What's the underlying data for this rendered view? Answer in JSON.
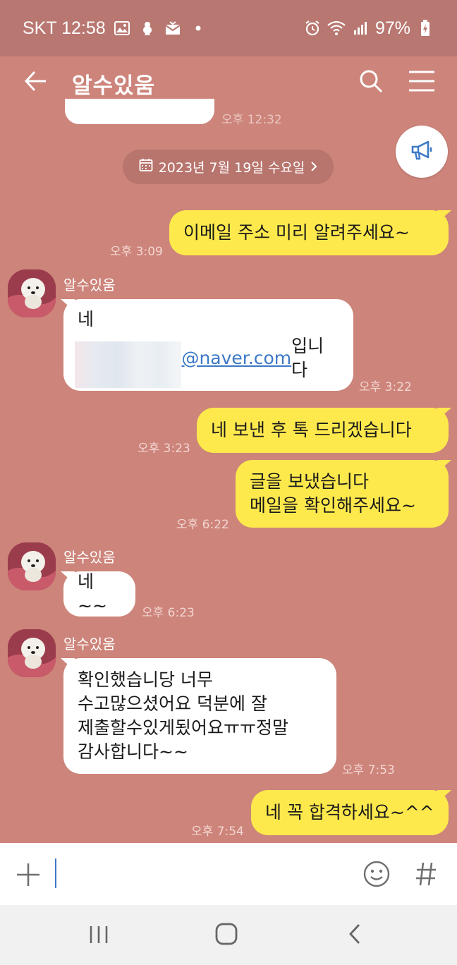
{
  "status_bar": {
    "carrier_time": "SKT 12:58",
    "battery": "97%"
  },
  "header": {
    "title": "알수있움"
  },
  "partial": {
    "time": "오후 12:32"
  },
  "date_divider": "2023년 7월 19일 수요일",
  "messages": [
    {
      "who": "me",
      "text": "이메일 주소 미리 알려주세요~",
      "time": "오후 3:09"
    },
    {
      "who": "other",
      "sender": "알수있움",
      "line1": "네",
      "email": "@naver.com",
      "suffix": "입니다",
      "time": "오후 3:22"
    },
    {
      "who": "me",
      "text": "네 보낸 후 톡 드리겠습니다",
      "time": "오후 3:23"
    },
    {
      "who": "me",
      "line1": "글을 보냈습니다",
      "line2": "메일을 확인해주세요~",
      "time": "오후 6:22"
    },
    {
      "who": "other",
      "sender": "알수있움",
      "text": "네~~",
      "time": "오후 6:23"
    },
    {
      "who": "other",
      "sender": "알수있움",
      "line1": "확인했습니당 너무",
      "line2": "수고많으셨어요 덕분에 잘",
      "line3": "제출할수있게됬어요ㅠㅠ정말",
      "line4": "감사합니다~~",
      "time": "오후 7:53"
    },
    {
      "who": "me",
      "text": "네 꼭 합격하세요~^^",
      "time": "오후 7:54"
    }
  ],
  "colors": {
    "chat_background": "#CD847A",
    "status_bar": "#B87770",
    "my_bubble": "#FEE94D",
    "their_bubble": "#FFFFFF"
  },
  "icons": {
    "back": "back-arrow-icon",
    "search": "search-icon",
    "menu": "hamburger-menu-icon",
    "notice": "megaphone-icon",
    "add": "plus-icon",
    "emoji": "emoji-icon",
    "hashtag": "hashtag-icon"
  }
}
